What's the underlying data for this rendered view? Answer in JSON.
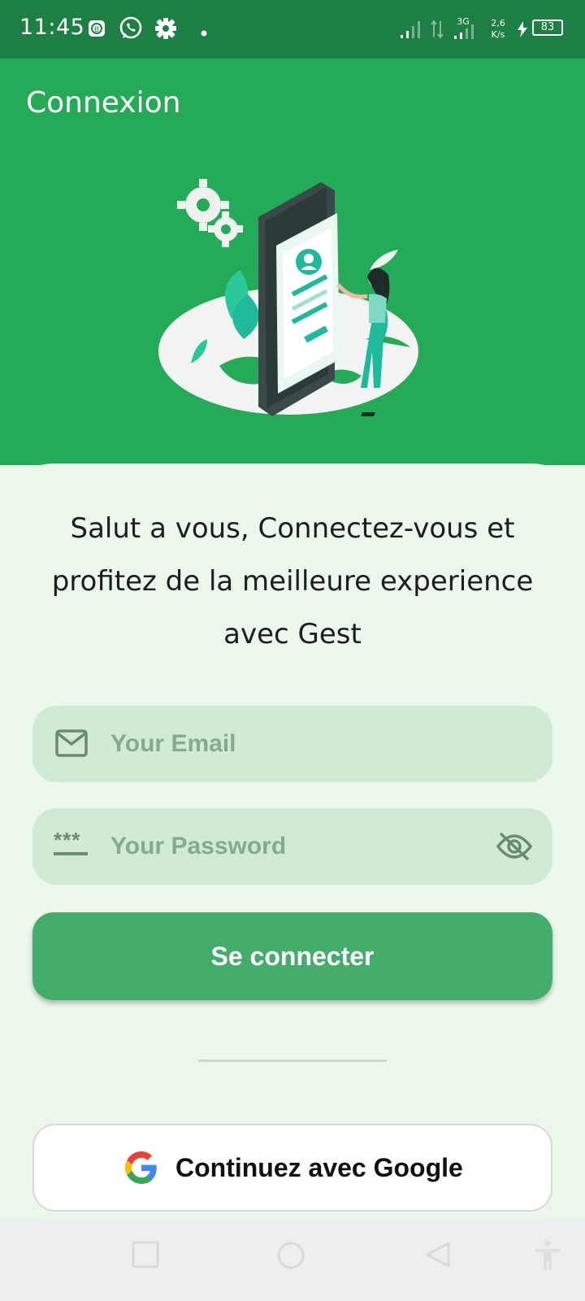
{
  "status_bar": {
    "time": "11:45",
    "network_type": "3G",
    "speed_value": "2,6",
    "speed_unit": "K/s",
    "battery": "83",
    "icons": [
      "bixby-icon",
      "whatsapp-icon",
      "settings-icon",
      "dot-icon",
      "signal-icon",
      "data-arrows-icon",
      "signal-3g-icon",
      "charging-icon",
      "battery-icon"
    ]
  },
  "appbar": {
    "title": "Connexion"
  },
  "card": {
    "greeting_line1": "Salut a vous, Connectez-vous et",
    "greeting_line2": "profitez de la meilleure experience",
    "greeting_line3": "avec Gest",
    "email": {
      "placeholder": "Your Email",
      "value": ""
    },
    "password": {
      "placeholder": "Your Password",
      "value": "",
      "icon_text": "***"
    },
    "login_label": "Se connecter",
    "google_label": "Continuez avec Google"
  },
  "colors": {
    "status_bar": "#1e7f44",
    "primary": "#25ab58",
    "button": "#45ad6b",
    "card_bg": "#eaf7ea",
    "field_bg": "#cfebd5"
  },
  "navbar": {
    "icons": [
      "recents-icon",
      "home-icon",
      "back-icon",
      "accessibility-icon"
    ]
  }
}
